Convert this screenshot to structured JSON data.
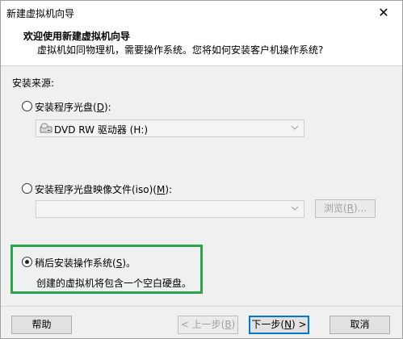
{
  "window": {
    "title": "新建虚拟机向导",
    "close_glyph": "✕"
  },
  "header": {
    "title": "欢迎使用新建虚拟机向导",
    "subtitle": "虚拟机如同物理机，需要操作系统。您将如何安装客户机操作系统?"
  },
  "install_source": {
    "label": "安装来源:",
    "options": [
      {
        "label_prefix": "安装程序光盘(",
        "mnemonic": "D",
        "label_suffix": "):",
        "selected": false
      },
      {
        "label_prefix": "安装程序光盘映像文件(iso)(",
        "mnemonic": "M",
        "label_suffix": "):",
        "selected": false
      },
      {
        "label_prefix": "稍后安装操作系统(",
        "mnemonic": "S",
        "label_suffix": ")。",
        "selected": true,
        "description": "创建的虚拟机将包含一个空白硬盘。"
      }
    ],
    "disc_drive": {
      "value": "DVD RW 驱动器 (H:)",
      "icon": "disc-drive-icon"
    },
    "iso_path": {
      "value": ""
    },
    "browse_button": {
      "label_prefix": "浏览(",
      "mnemonic": "R",
      "label_suffix": ")..."
    }
  },
  "footer": {
    "help": "帮助",
    "back": {
      "prefix": "< 上一步(",
      "mnemonic": "B",
      "suffix": ")"
    },
    "next": {
      "prefix": "下一步(",
      "mnemonic": "N",
      "suffix": ") >"
    },
    "cancel": "取消"
  },
  "colors": {
    "highlight_border": "#2aa54a",
    "default_button_border": "#0078d7"
  }
}
